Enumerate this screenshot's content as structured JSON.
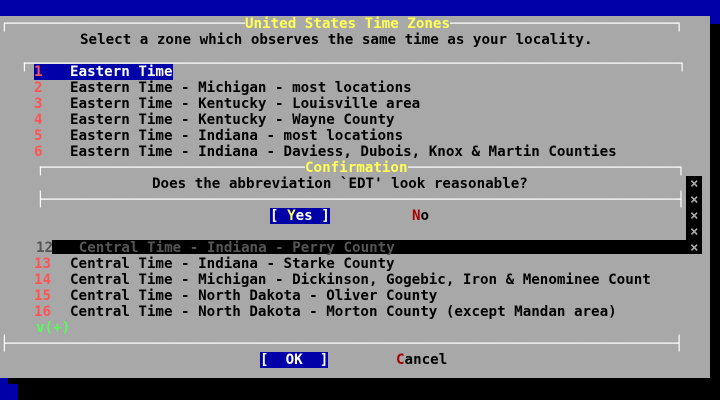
{
  "dialog": {
    "title": "United States Time Zones",
    "prompt": "Select a zone which observes the same time as your locality."
  },
  "zones": [
    {
      "num": "1",
      "label": "Eastern Time"
    },
    {
      "num": "2",
      "label": "Eastern Time - Michigan - most locations"
    },
    {
      "num": "3",
      "label": "Eastern Time - Kentucky - Louisville area"
    },
    {
      "num": "4",
      "label": "Eastern Time - Kentucky - Wayne County"
    },
    {
      "num": "5",
      "label": "Eastern Time - Indiana - most locations"
    },
    {
      "num": "6",
      "label": "Eastern Time - Indiana - Daviess, Dubois, Knox & Martin Counties"
    },
    {
      "num": "12",
      "label": "Central Time - Indiana - Perry County"
    },
    {
      "num": "13",
      "label": "Central Time - Indiana - Starke County"
    },
    {
      "num": "14",
      "label": "Central Time - Michigan - Dickinson, Gogebic, Iron & Menominee Count"
    },
    {
      "num": "15",
      "label": "Central Time - North Dakota - Oliver County"
    },
    {
      "num": "16",
      "label": "Central Time - North Dakota - Morton County (except Mandan area)"
    }
  ],
  "scroll_indicator": "v(+)",
  "confirm": {
    "title": "Confirmation",
    "question": "Does the abbreviation `EDT' look reasonable?",
    "yes_open": "[ ",
    "yes_hot": "Y",
    "yes_rest": "es ]",
    "no_hot": "N",
    "no_rest": "o"
  },
  "buttons": {
    "ok_text": "[  OK  ]",
    "cancel_hot": "C",
    "cancel_rest": "ancel"
  },
  "colors": {
    "background": "#0000a8",
    "dialog": "#a8a8a8",
    "title": "#ffff54",
    "number": "#ff5454",
    "selected": "#0000a8"
  }
}
